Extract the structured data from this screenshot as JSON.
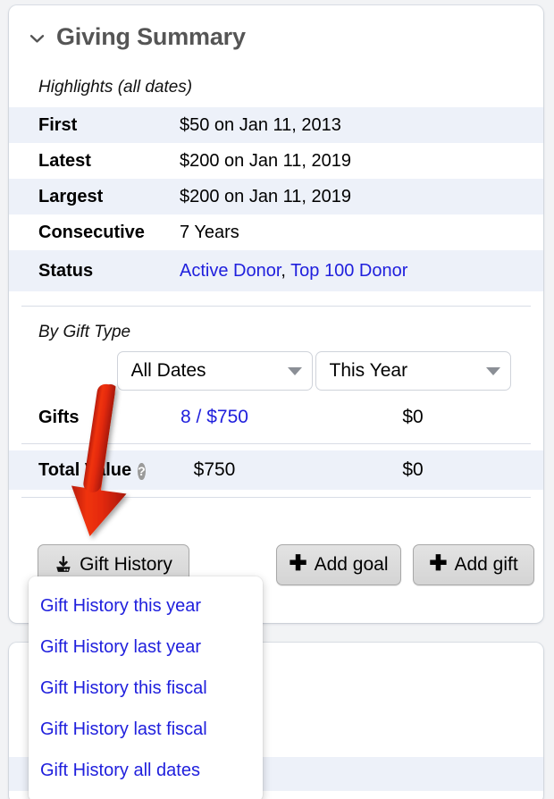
{
  "card": {
    "title": "Giving Summary",
    "collapse_icon": "chevron-down-icon"
  },
  "highlights": {
    "heading": "Highlights (all dates)",
    "rows": [
      {
        "label": "First",
        "value": "$50 on Jan 11, 2013"
      },
      {
        "label": "Latest",
        "value": "$200 on Jan 11, 2019"
      },
      {
        "label": "Largest",
        "value": "$200 on Jan 11, 2019"
      },
      {
        "label": "Consecutive",
        "value": "7 Years"
      }
    ],
    "status": {
      "label": "Status",
      "links": [
        "Active Donor",
        "Top 100 Donor"
      ],
      "separator": ","
    }
  },
  "by_gift_type": {
    "heading": "By Gift Type",
    "selects": [
      {
        "name": "date-range-select-left",
        "value": "All Dates",
        "icon": "chevron-down-icon"
      },
      {
        "name": "date-range-select-right",
        "value": "This Year",
        "icon": "chevron-down-icon"
      }
    ],
    "gifts_row": {
      "label": "Gifts",
      "left_value": "8 / $750",
      "right_value": "$0"
    },
    "total_value_row": {
      "label": "Total Value",
      "help_icon": "question-mark-icon",
      "left_value": "$750",
      "right_value": "$0"
    }
  },
  "actions": {
    "gift_history": {
      "label": "Gift History",
      "icon": "download-icon"
    },
    "add_goal": {
      "label": "Add goal",
      "icon": "plus-icon"
    },
    "add_gift": {
      "label": "Add gift",
      "icon": "plus-icon"
    }
  },
  "gift_history_menu": {
    "items": [
      "Gift History this year",
      "Gift History last year",
      "Gift History this fiscal",
      "Gift History last fiscal",
      "Gift History all dates"
    ]
  },
  "annotation": {
    "arrow_color": "#e02b13",
    "points_to": "Gift History"
  },
  "colors": {
    "link": "#2020dd",
    "alt_row": "#edf1f9",
    "title": "#555555",
    "rule": "#d8dde6",
    "arrow": "#e02b13"
  }
}
